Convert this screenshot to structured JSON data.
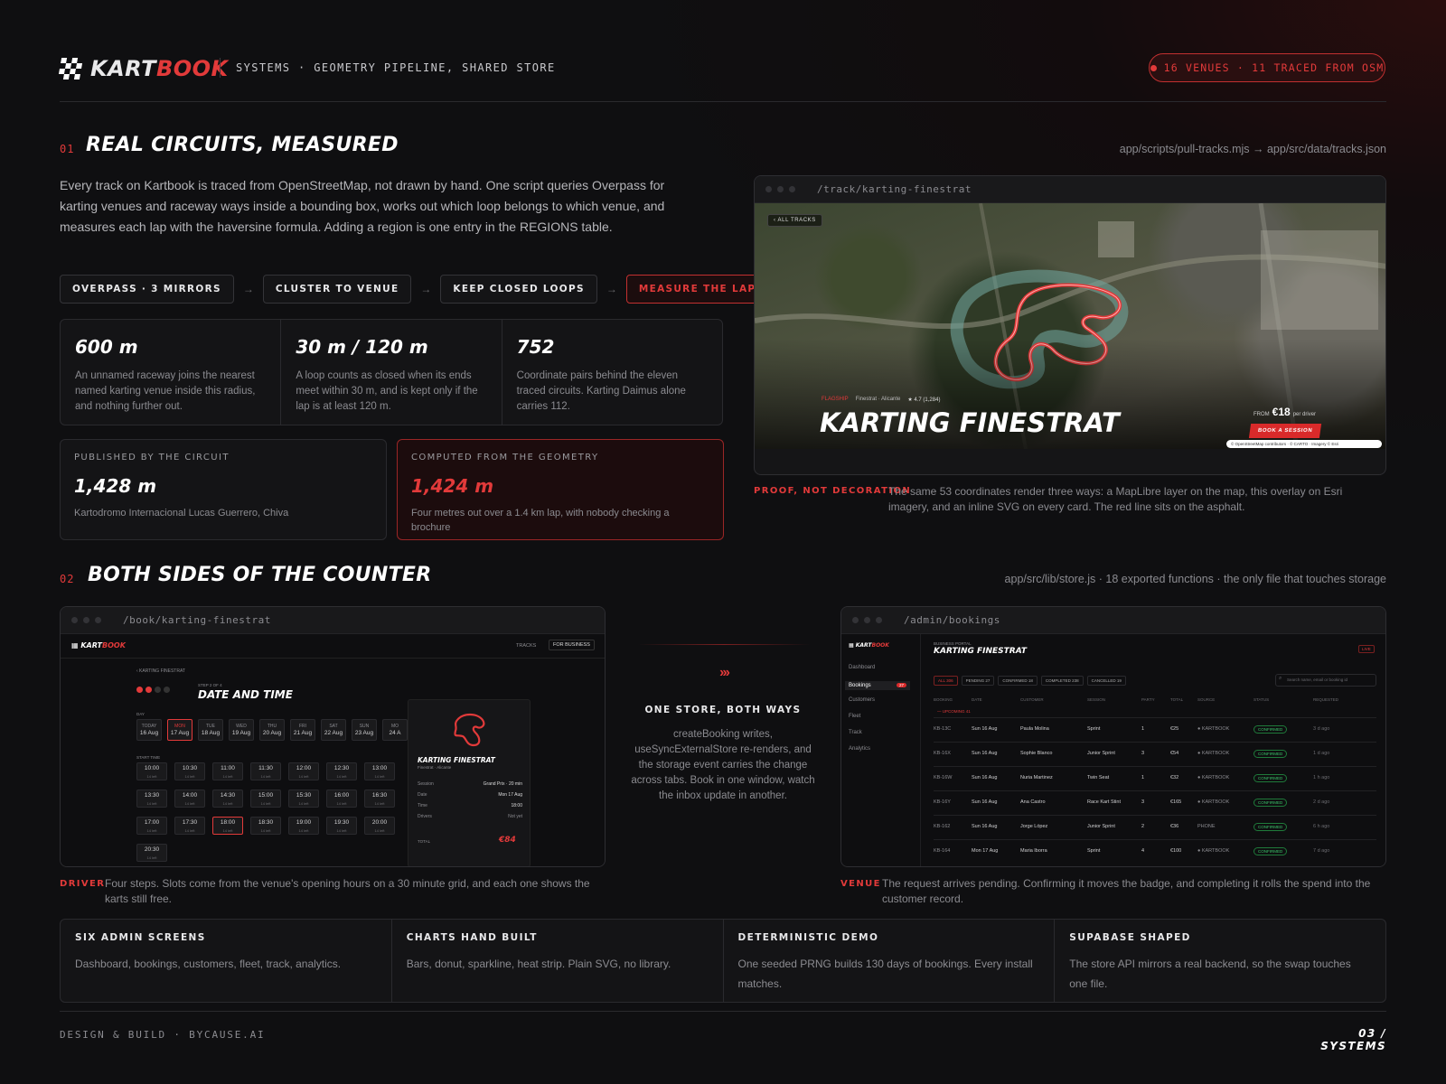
{
  "header": {
    "brand_a": "KART",
    "brand_b": "BOOK",
    "subtitle": "SYSTEMS · GEOMETRY PIPELINE, SHARED STORE",
    "pill": "16 VENUES · 11 TRACED FROM OSM"
  },
  "s1": {
    "num": "01",
    "title": "REAL CIRCUITS, MEASURED",
    "path": "app/scripts/pull-tracks.mjs → app/src/data/tracks.json",
    "intro": "Every track on Kartbook is traced from OpenStreetMap, not drawn by hand. One script queries Overpass for karting venues and raceway ways inside a bounding box, works out which loop belongs to which venue, and measures each lap with the haversine formula. Adding a region is one entry in the REGIONS table.",
    "chips": [
      "OVERPASS · 3 MIRRORS",
      "CLUSTER TO VENUE",
      "KEEP CLOSED LOOPS",
      "MEASURE THE LAP"
    ],
    "stats": [
      {
        "value": "600 m",
        "desc": "An unnamed raceway joins the nearest named karting venue inside this radius, and nothing further out."
      },
      {
        "value": "30 m / 120 m",
        "desc": "A loop counts as closed when its ends meet within 30 m, and is kept only if the lap is at least 120 m."
      },
      {
        "value": "752",
        "desc": "Coordinate pairs behind the eleven traced circuits. Karting Daimus alone carries 112."
      }
    ],
    "published": {
      "label": "PUBLISHED BY THE CIRCUIT",
      "value": "1,428 m",
      "note": "Kartodromo Internacional Lucas Guerrero, Chiva"
    },
    "computed": {
      "label": "COMPUTED FROM THE GEOMETRY",
      "value": "1,424 m",
      "note": "Four metres out over a 1.4 km lap, with nobody checking a brochure"
    },
    "track_url": "/track/karting-finestrat",
    "track": {
      "back": "‹ ALL TRACKS",
      "flag": "FLAGSHIP",
      "loc": "Finestrat · Alicante",
      "rating": "★ 4.7 (1,284)",
      "name": "KARTING FINESTRAT",
      "from": "FROM",
      "price": "€18",
      "per": "per driver",
      "cta": "BOOK A SESSION",
      "attr": "© OpenStreetMap contributors · © CARTO · Imagery © Esri"
    },
    "proof_tag": "PROOF, NOT DECORATION",
    "proof_txt": "The same 53 coordinates render three ways: a MapLibre layer on the map, this overlay on Esri imagery, and an inline SVG on every card. The red line sits on the asphalt."
  },
  "s2": {
    "num": "02",
    "title": "BOTH SIDES OF THE COUNTER",
    "path": "app/src/lib/store.js · 18 exported functions · the only file that touches storage",
    "book_url": "/book/karting-finestrat",
    "admin_url": "/admin/bookings",
    "mid_title": "ONE STORE, BOTH WAYS",
    "mid_txt": "createBooking writes, useSyncExternalStore re-renders, and the storage event carries the change across tabs. Book in one window, watch the inbox update in another.",
    "driver_tag": "DRIVER",
    "driver_txt": "Four steps. Slots come from the venue's opening hours on a 30 minute grid, and each one shows the karts still free.",
    "venue_tag": "VENUE",
    "venue_txt": "The request arrives pending. Confirming it moves the badge, and completing it rolls the spend into the customer record.",
    "booking": {
      "nav1": "TRACKS",
      "nav2": "FOR BUSINESS",
      "crumb": "‹ KARTING FINESTRAT",
      "step": "STEP 2 OF 4",
      "title": "DATE AND TIME",
      "day_lbl": "DAY",
      "days": [
        [
          "TODAY",
          "16 Aug"
        ],
        [
          "MON",
          "17 Aug"
        ],
        [
          "TUE",
          "18 Aug"
        ],
        [
          "WED",
          "19 Aug"
        ],
        [
          "THU",
          "20 Aug"
        ],
        [
          "FRI",
          "21 Aug"
        ],
        [
          "SAT",
          "22 Aug"
        ],
        [
          "SUN",
          "23 Aug"
        ],
        [
          "MO",
          "24 A"
        ]
      ],
      "start_lbl": "START TIME",
      "times": [
        "10:00",
        "10:30",
        "11:00",
        "11:30",
        "12:00",
        "12:30",
        "13:00",
        "13:30",
        "14:00",
        "14:30",
        "15:00",
        "15:30",
        "16:00",
        "16:30",
        "17:00",
        "17:30",
        "18:00",
        "18:30",
        "19:00",
        "19:30",
        "20:00",
        "20:30"
      ],
      "left": "14 left",
      "side_name": "KARTING FINESTRAT",
      "side_loc": "Finestrat · Alicante",
      "rows": [
        [
          "Session",
          "Grand Prix · 20 min"
        ],
        [
          "Date",
          "Mon 17 Aug"
        ],
        [
          "Time",
          "18:00"
        ],
        [
          "Drivers",
          "Not yet"
        ]
      ],
      "total_lbl": "TOTAL",
      "total": "€84"
    },
    "admin": {
      "side": [
        "Dashboard",
        "Bookings",
        "Customers",
        "Fleet",
        "Track",
        "Analytics"
      ],
      "badge": "27",
      "portal": "BUSINESS PORTAL",
      "title": "KARTING FINESTRAT",
      "live": "LIVE",
      "tabs": [
        "ALL 306",
        "PENDING 27",
        "CONFIRMED 18",
        "COMPLETED 238",
        "CANCELLED 19"
      ],
      "search": "Search name, email or booking id",
      "cols": [
        "BOOKING",
        "DATE",
        "CUSTOMER",
        "SESSION",
        "PARTY",
        "TOTAL",
        "SOURCE",
        "STATUS",
        "REQUESTED"
      ],
      "upcoming": "— UPCOMING 41",
      "rows": [
        [
          "KB-13C",
          "Sun 16 Aug",
          "Paula Molina",
          "Sprint",
          "1",
          "€25",
          "● KARTBOOK",
          "CONFIRMED",
          "3 d ago"
        ],
        [
          "KB-16X",
          "Sun 16 Aug",
          "Sophie Blanco",
          "Junior Sprint",
          "3",
          "€54",
          "● KARTBOOK",
          "CONFIRMED",
          "1 d ago"
        ],
        [
          "KB-16W",
          "Sun 16 Aug",
          "Nuria Martinez",
          "Twin Seat",
          "1",
          "€32",
          "● KARTBOOK",
          "CONFIRMED",
          "1 h ago"
        ],
        [
          "KB-16Y",
          "Sun 16 Aug",
          "Ana Castro",
          "Race Kart Stint",
          "3",
          "€165",
          "● KARTBOOK",
          "CONFIRMED",
          "2 d ago"
        ],
        [
          "KB-162",
          "Sun 16 Aug",
          "Jorge López",
          "Junior Sprint",
          "2",
          "€36",
          "PHONE",
          "CONFIRMED",
          "6 h ago"
        ],
        [
          "KB-164",
          "Mon 17 Aug",
          "Maria Iborra",
          "Sprint",
          "4",
          "€100",
          "● KARTBOOK",
          "CONFIRMED",
          "7 d ago"
        ]
      ]
    }
  },
  "features": [
    {
      "title": "SIX ADMIN SCREENS",
      "text": "Dashboard, bookings, customers, fleet, track, analytics."
    },
    {
      "title": "CHARTS HAND BUILT",
      "text": "Bars, donut, sparkline, heat strip. Plain SVG, no library."
    },
    {
      "title": "DETERMINISTIC DEMO",
      "text": "One seeded PRNG builds 130 days of bookings. Every install matches."
    },
    {
      "title": "SUPABASE SHAPED",
      "text": "The store API mirrors a real backend, so the swap touches one file."
    }
  ],
  "footer": {
    "left": "DESIGN & BUILD · BYCAUSE.AI",
    "right": "03 / SYSTEMS"
  }
}
